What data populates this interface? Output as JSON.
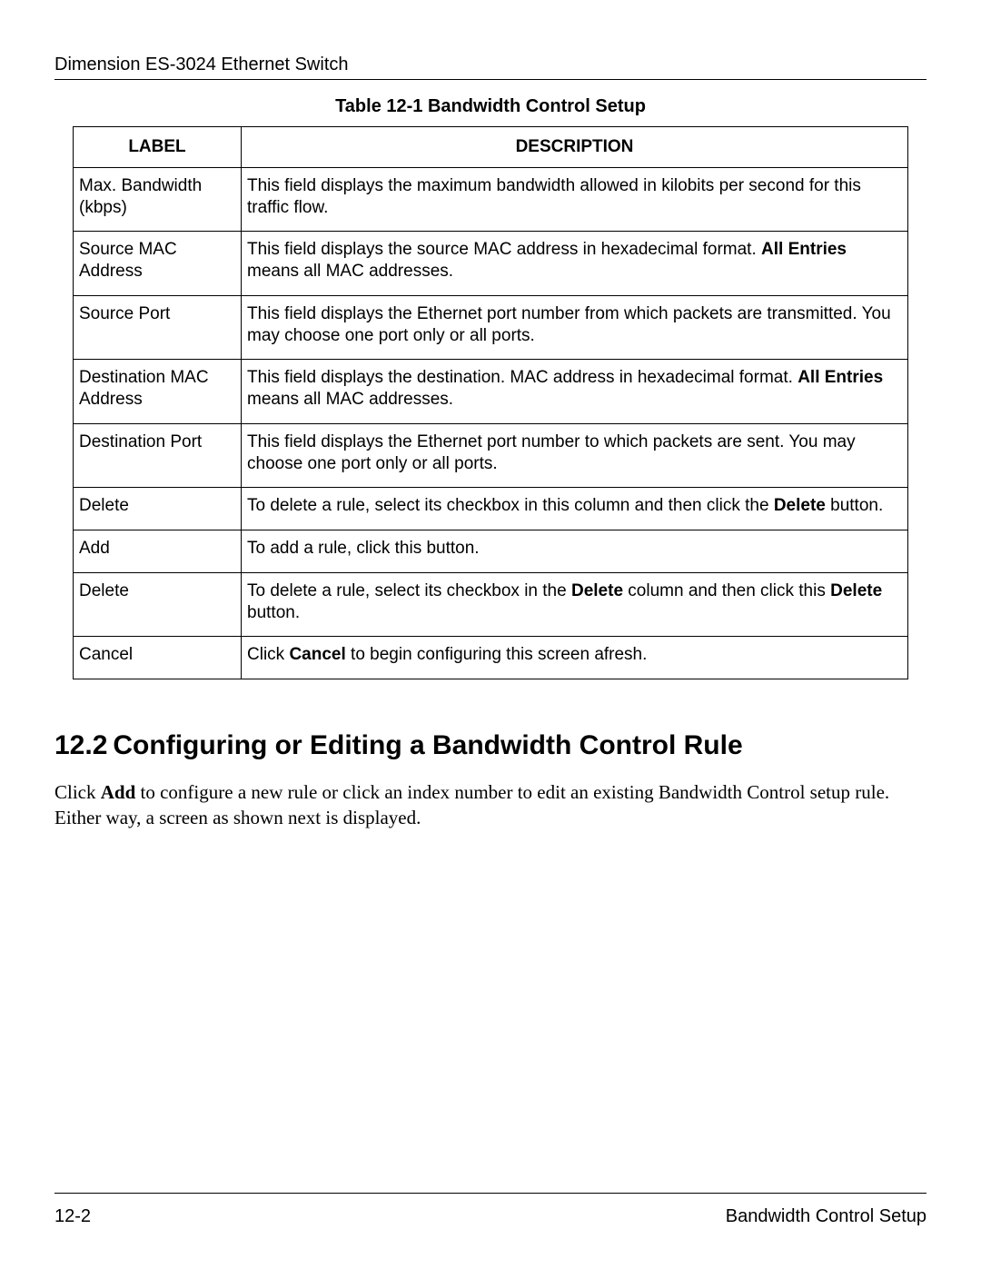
{
  "header": {
    "product": "Dimension ES-3024 Ethernet Switch"
  },
  "table": {
    "caption": "Table 12-1 Bandwidth Control Setup",
    "headers": {
      "label": "LABEL",
      "description": "DESCRIPTION"
    },
    "rows": [
      {
        "label": "Max. Bandwidth (kbps)",
        "desc_parts": [
          {
            "t": "This field displays the maximum bandwidth allowed in kilobits per second for this traffic flow."
          }
        ]
      },
      {
        "label": "Source MAC Address",
        "desc_parts": [
          {
            "t": "This field displays the source MAC address in hexadecimal format. "
          },
          {
            "t": "All Entries",
            "b": true
          },
          {
            "t": " means all MAC addresses."
          }
        ]
      },
      {
        "label": "Source Port",
        "desc_parts": [
          {
            "t": "This field displays the Ethernet port number from which packets are transmitted. You may choose one port only or all ports."
          }
        ]
      },
      {
        "label": "Destination MAC Address",
        "desc_parts": [
          {
            "t": "This field displays the destination. MAC address in hexadecimal format. "
          },
          {
            "t": "All Entries",
            "b": true
          },
          {
            "t": " means all MAC addresses."
          }
        ]
      },
      {
        "label": "Destination Port",
        "desc_parts": [
          {
            "t": "This field displays the Ethernet port number to which packets are sent. You may choose one port only or all ports."
          }
        ]
      },
      {
        "label": "Delete",
        "desc_parts": [
          {
            "t": "To delete a rule, select its checkbox in this column and then click the "
          },
          {
            "t": "Delete",
            "b": true
          },
          {
            "t": " button."
          }
        ]
      },
      {
        "label": "Add",
        "desc_parts": [
          {
            "t": "To add a rule, click this button."
          }
        ]
      },
      {
        "label": "Delete",
        "desc_parts": [
          {
            "t": "To delete a rule, select its checkbox in the "
          },
          {
            "t": "Delete",
            "b": true
          },
          {
            "t": " column and then click this "
          },
          {
            "t": "Delete",
            "b": true
          },
          {
            "t": " button."
          }
        ]
      },
      {
        "label": "Cancel",
        "desc_parts": [
          {
            "t": "Click "
          },
          {
            "t": "Cancel",
            "b": true
          },
          {
            "t": " to begin configuring this screen afresh."
          }
        ]
      }
    ]
  },
  "section": {
    "number": "12.2",
    "title": "Configuring or Editing a Bandwidth Control Rule",
    "body_parts": [
      {
        "t": "Click "
      },
      {
        "t": "Add",
        "b": true
      },
      {
        "t": " to configure a new rule or click an index number to edit an existing Bandwidth Control setup rule. Either way, a screen as shown next is displayed."
      }
    ]
  },
  "footer": {
    "page": "12-2",
    "label": "Bandwidth Control Setup"
  }
}
